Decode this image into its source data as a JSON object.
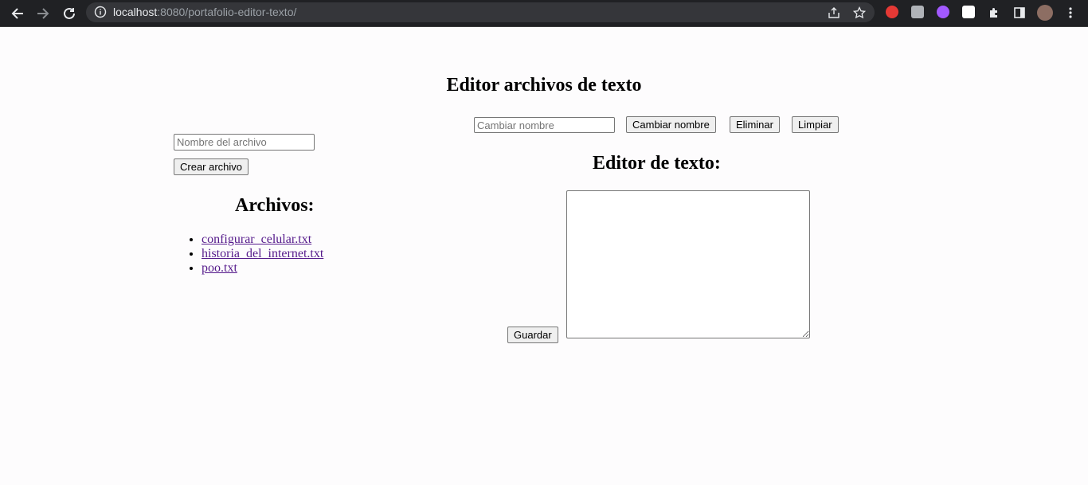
{
  "browser": {
    "url_host": "localhost",
    "url_rest": ":8080/portafolio-editor-texto/"
  },
  "page": {
    "title": "Editor archivos de texto"
  },
  "toolbar": {
    "rename_placeholder": "Cambiar nombre",
    "rename_button": "Cambiar nombre",
    "delete_button": "Eliminar",
    "clear_button": "Limpiar"
  },
  "create": {
    "filename_placeholder": "Nombre del archivo",
    "create_button": "Crear archivo"
  },
  "files": {
    "heading": "Archivos:",
    "items": [
      {
        "name": "configurar_celular.txt"
      },
      {
        "name": "historia_del_internet.txt"
      },
      {
        "name": "poo.txt"
      }
    ]
  },
  "editor": {
    "heading": "Editor de texto:",
    "save_button": "Guardar",
    "content": ""
  },
  "colors": {
    "chrome_bg": "#202124",
    "omnibox_bg": "#35363a",
    "link_visited": "#551a8b",
    "page_bg": "#fdfcfd"
  }
}
